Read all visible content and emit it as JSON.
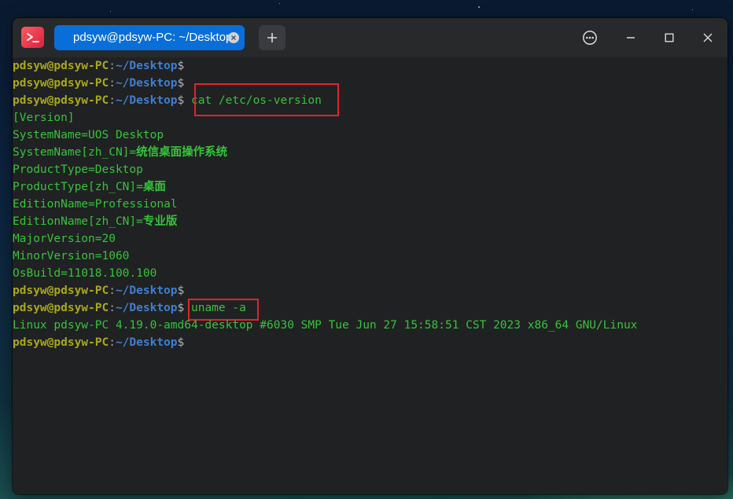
{
  "window": {
    "tab_title": "pdsyw@pdsyw-PC: ~/Desktop"
  },
  "colors": {
    "terminal_bg": "#202123",
    "user_host": "#a8a81a",
    "path": "#3f7fd0",
    "output": "#36c33a",
    "tab_active": "#0a6ed8",
    "highlight": "#e0242c"
  },
  "icons": {
    "app": "terminal-app-icon",
    "tab_close": "close-icon",
    "new_tab": "plus-icon",
    "menu": "more-icon",
    "minimize": "minimize-icon",
    "maximize": "maximize-icon",
    "close": "close-icon"
  },
  "prompt": {
    "user_host": "pdsyw@pdsyw-PC",
    "separator": ":",
    "path": "~/Desktop",
    "dollar": "$"
  },
  "terminal": {
    "commands": {
      "cat": " cat /etc/os-version",
      "uname": " uname -a"
    },
    "os_version": {
      "l1": "[Version]",
      "l2_key": "SystemName=",
      "l2_val": "UOS Desktop",
      "l3_key": "SystemName[zh_CN]=",
      "l3_val": "统信桌面操作系统",
      "l4_key": "ProductType=",
      "l4_val": "Desktop",
      "l5_key": "ProductType[zh_CN]=",
      "l5_val": "桌面",
      "l6_key": "EditionName=",
      "l6_val": "Professional",
      "l7_key": "EditionName[zh_CN]=",
      "l7_val": "专业版",
      "l8": "MajorVersion=20",
      "l9": "MinorVersion=1060",
      "l10": "OsBuild=11018.100.100"
    },
    "uname_output": "Linux pdsyw-PC 4.19.0-amd64-desktop #6030 SMP Tue Jun 27 15:58:51 CST 2023 x86_64 GNU/Linux"
  }
}
